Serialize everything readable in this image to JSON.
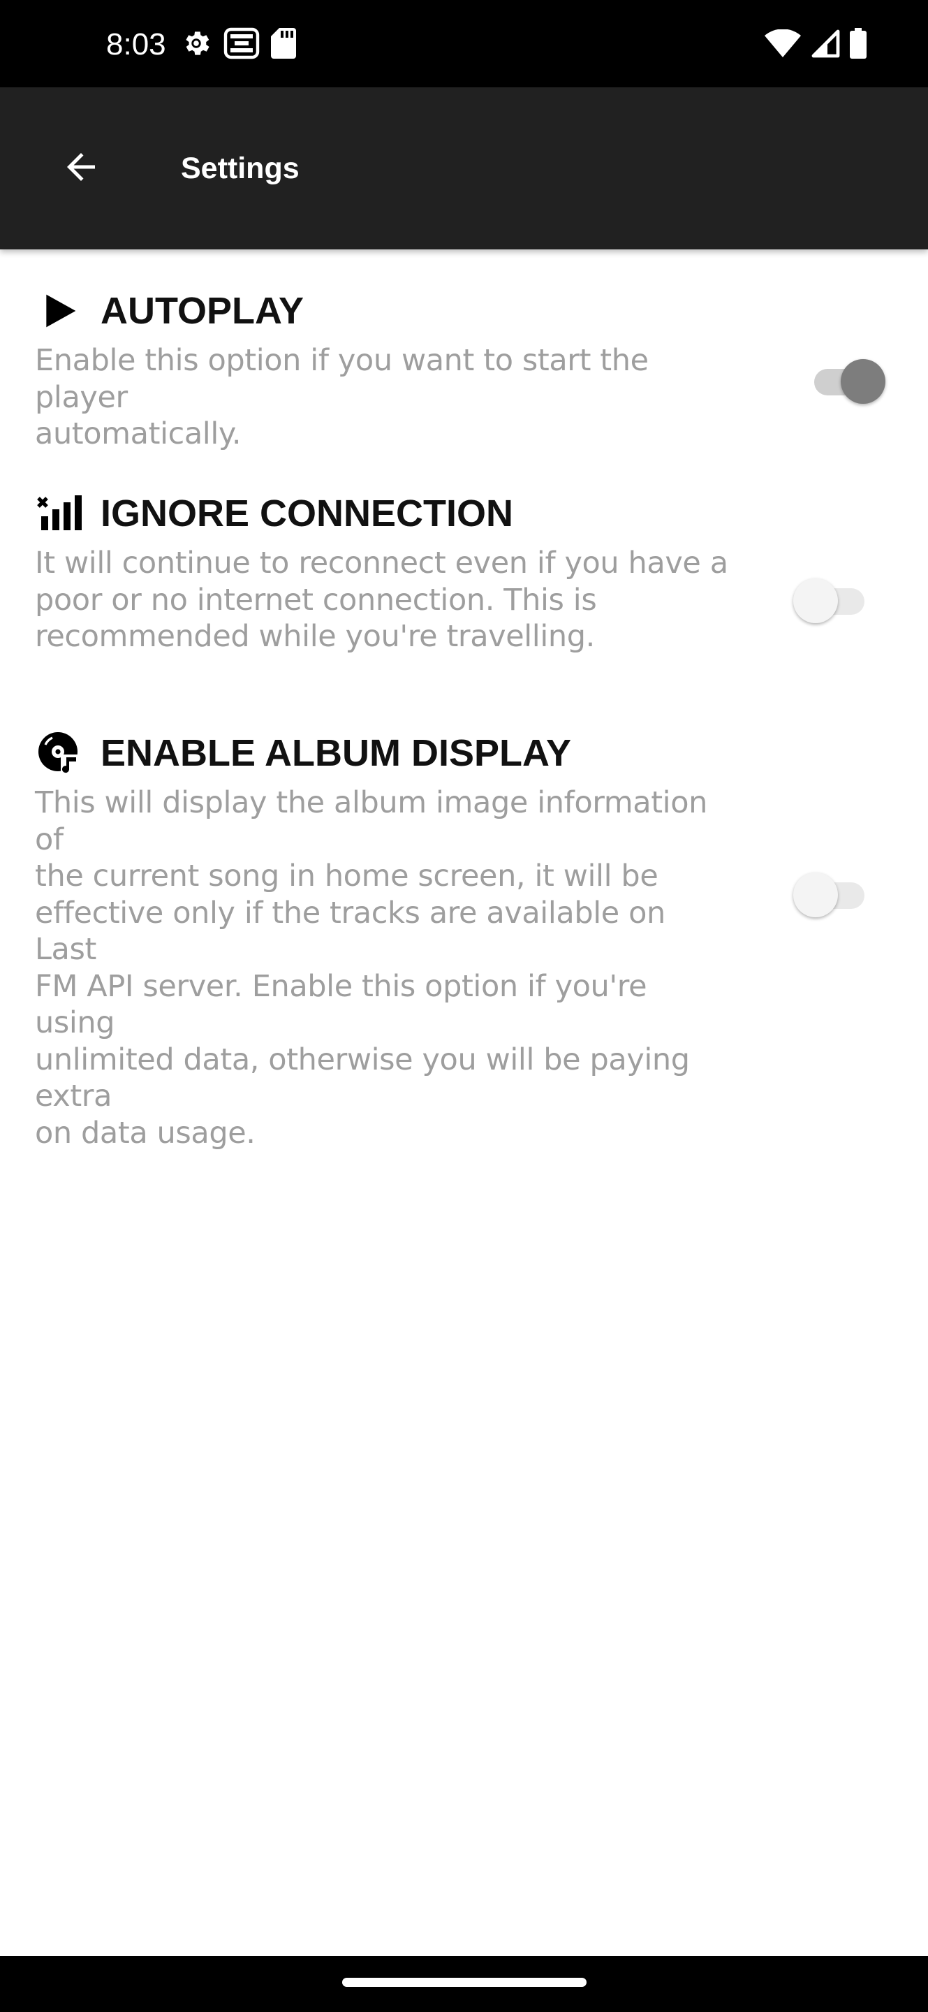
{
  "status_bar": {
    "time": "8:03",
    "left_icons": [
      "gear-icon",
      "notification-app-icon",
      "sd-card-icon"
    ],
    "right_icons": [
      "wifi-icon",
      "cell-signal-icon",
      "battery-icon"
    ]
  },
  "app_bar": {
    "back_icon": "arrow-left-icon",
    "title": "Settings",
    "background": "#212121"
  },
  "settings": [
    {
      "id": "autoplay",
      "icon": "play-icon",
      "title": "AUTOPLAY",
      "description": "Enable this option if you want to start the player\nautomatically.",
      "enabled": true
    },
    {
      "id": "ignore-connection",
      "icon": "signal-off-icon",
      "title": "IGNORE CONNECTION",
      "description": "It will continue to reconnect even if you have a\npoor or no internet connection. This is\nrecommended while you're travelling.",
      "enabled": false
    },
    {
      "id": "enable-album-display",
      "icon": "album-disc-icon",
      "title": "ENABLE ALBUM DISPLAY",
      "description": "This will display the album image information of\nthe current song in home screen, it will be\neffective only if the tracks are available on Last\nFM API server. Enable this option if you're using\nunlimited data, otherwise you will be paying extra\non data usage.",
      "enabled": false
    }
  ],
  "colors": {
    "switch_on_thumb": "#7d7d7d",
    "switch_on_track": "#cfcfcf",
    "switch_off_thumb": "#f4f4f4",
    "switch_off_track": "#e9e9e9",
    "description_text": "#9e9e9e"
  }
}
